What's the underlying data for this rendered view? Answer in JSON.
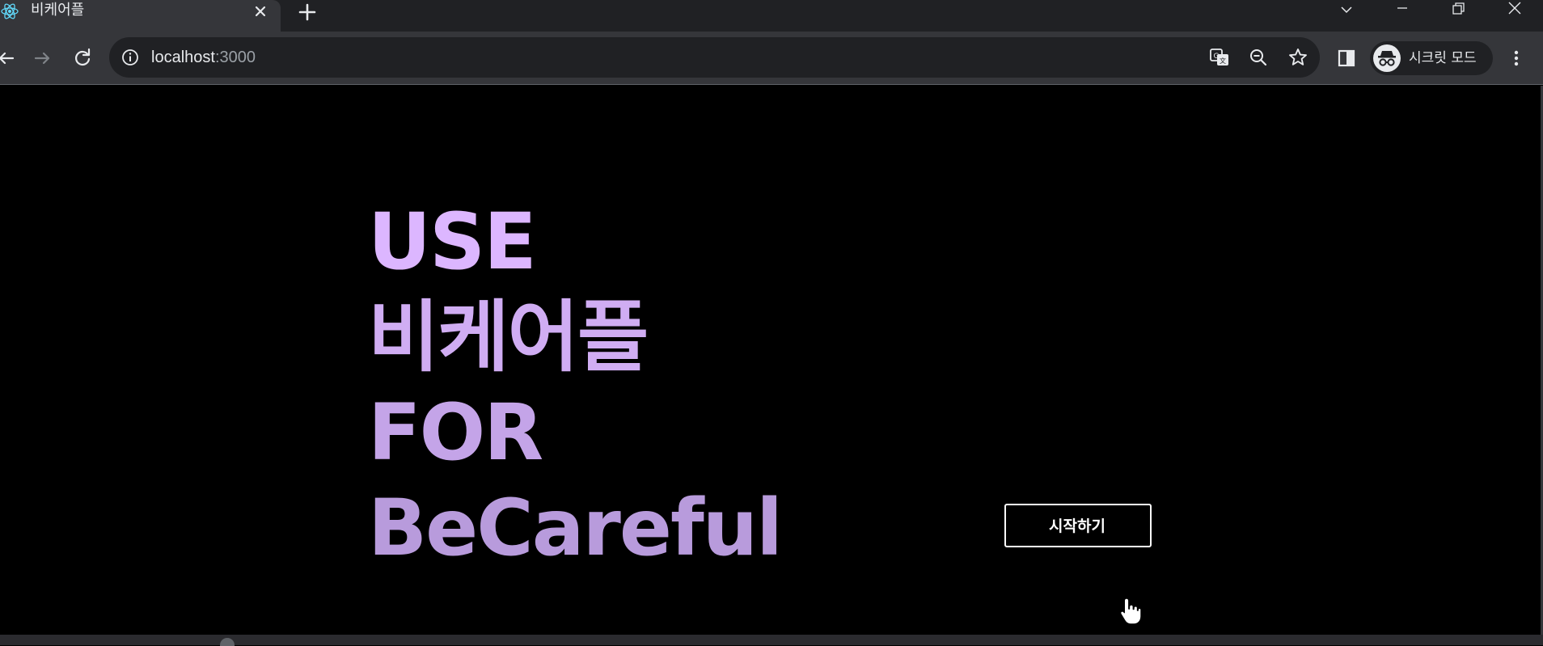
{
  "tab": {
    "title": "비케어플",
    "favicon": "react-logo-icon",
    "close_icon": "close-icon",
    "new_tab_icon": "plus-icon"
  },
  "window_controls": {
    "tab_search_icon": "chevron-down-icon",
    "minimize_icon": "minimize-icon",
    "restore_icon": "restore-icon",
    "close_icon": "close-icon"
  },
  "toolbar": {
    "back_icon": "arrow-left-icon",
    "forward_icon": "arrow-right-icon",
    "reload_icon": "reload-icon",
    "site_info_icon": "info-icon",
    "url_host": "localhost",
    "url_port": ":3000",
    "translate_icon": "translate-icon",
    "zoom_icon": "zoom-out-icon",
    "bookmark_icon": "star-icon",
    "side_panel_icon": "side-panel-icon",
    "profile_icon": "incognito-icon",
    "profile_label": "시크릿 모드",
    "menu_icon": "kebab-menu-icon"
  },
  "hero": {
    "lines": [
      "USE",
      "비케어플",
      "FOR",
      "BeCareful"
    ],
    "colors": {
      "top": "#dcb6ff",
      "bottom": "#b89bdc"
    }
  },
  "start_button": {
    "label": "시작하기"
  },
  "cursor_icon": "hand-pointer-icon",
  "colors": {
    "page_background": "#000000",
    "toolbar_background": "#35363a",
    "tabstrip_background": "#202124",
    "text_light": "#e8eaed",
    "text_muted": "#9aa0a6"
  }
}
